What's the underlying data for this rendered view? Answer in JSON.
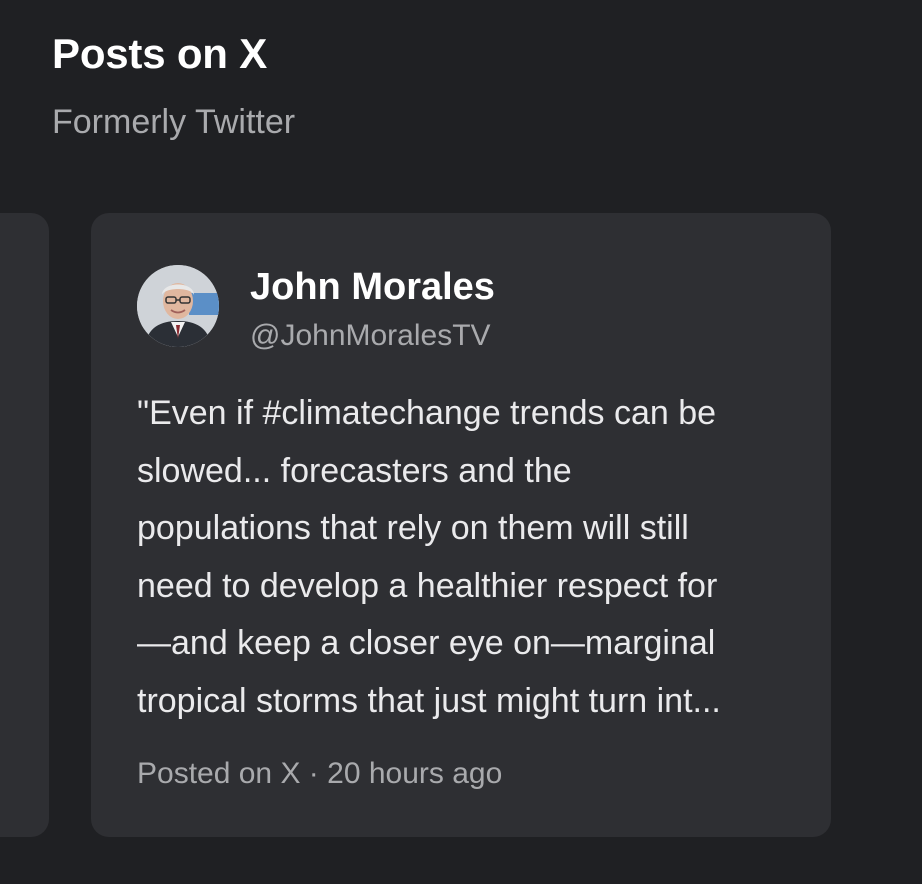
{
  "section": {
    "title": "Posts on X",
    "subtitle": "Formerly Twitter"
  },
  "post": {
    "author_name": "John Morales",
    "author_handle": "@JohnMoralesTV",
    "avatar_icon": "profile-photo-icon",
    "text_lines": [
      "\"Even if #climatechange trends can be",
      "slowed... forecasters and the",
      "populations that rely on them will still",
      "need to develop a healthier respect for",
      "—and keep a closer eye on—marginal",
      "tropical storms that just might turn int..."
    ],
    "meta": {
      "source": "Posted on X",
      "separator": "·",
      "time": "20 hours ago"
    }
  },
  "colors": {
    "background": "#1f2023",
    "card": "#2e2f33",
    "text_primary": "#ffffff",
    "text_secondary": "#a9aaad"
  }
}
